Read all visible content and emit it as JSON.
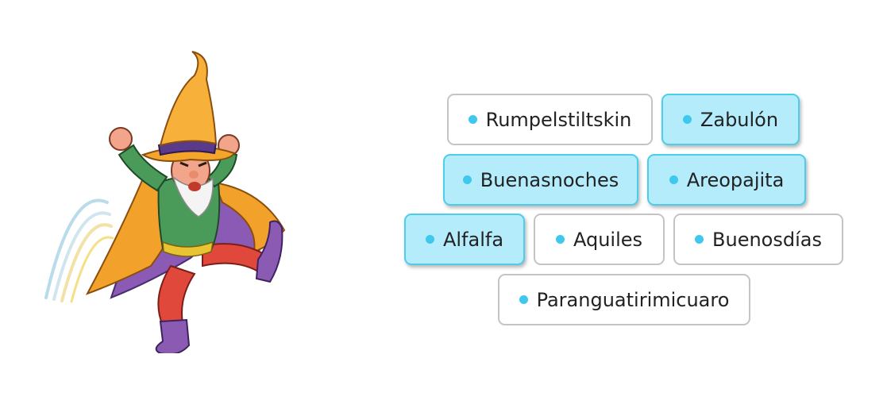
{
  "illustration": {
    "icon": "angry-wizard-illustration"
  },
  "colors": {
    "selected_bg": "#b4ecfb",
    "selected_border": "#4ccde9",
    "dot": "#3ec8ee",
    "border": "#c4c4c4"
  },
  "options": [
    {
      "label": "Rumpelstiltskin",
      "selected": false
    },
    {
      "label": "Zabulón",
      "selected": true
    },
    {
      "label": "Buenasnoches",
      "selected": true
    },
    {
      "label": "Areopajita",
      "selected": true
    },
    {
      "label": "Alfalfa",
      "selected": true
    },
    {
      "label": "Aquiles",
      "selected": false
    },
    {
      "label": "Buenosdías",
      "selected": false
    },
    {
      "label": "Paranguatirimicuaro",
      "selected": false
    }
  ]
}
